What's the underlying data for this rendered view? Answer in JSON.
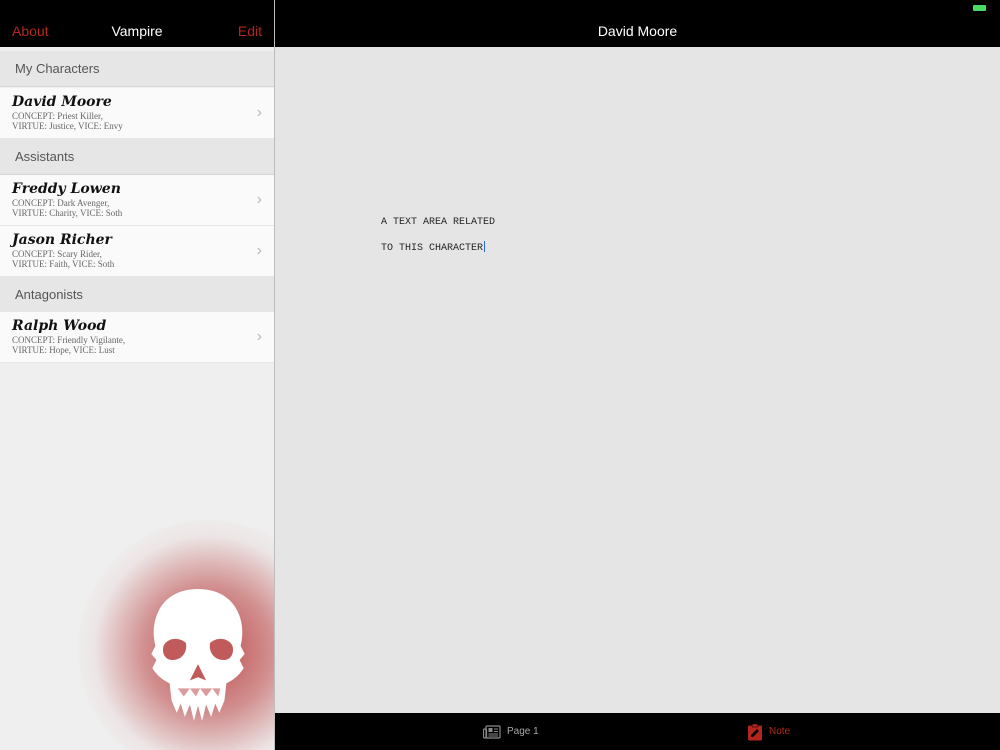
{
  "master": {
    "nav": {
      "left": "About",
      "title": "Vampire",
      "right": "Edit"
    },
    "sections": [
      {
        "title": "My Characters",
        "items": [
          {
            "name": "David Moore",
            "line1": "CONCEPT: Priest Killer,",
            "line2": "VIRTUE: Justice, VICE: Envy"
          }
        ]
      },
      {
        "title": "Assistants",
        "items": [
          {
            "name": "Freddy Lowen",
            "line1": "CONCEPT: Dark Avenger,",
            "line2": "VIRTUE: Charity, VICE: Soth"
          },
          {
            "name": "Jason Richer",
            "line1": "CONCEPT: Scary Rider,",
            "line2": "VIRTUE: Faith, VICE: Soth"
          }
        ]
      },
      {
        "title": "Antagonists",
        "items": [
          {
            "name": "Ralph Wood",
            "line1": "CONCEPT: Friendly Vigilante,",
            "line2": "VIRTUE: Hope, VICE: Lust"
          }
        ]
      }
    ]
  },
  "detail": {
    "title": "David Moore",
    "text_lines": [
      "A TEXT AREA RELATED",
      "TO THIS CHARACTER"
    ]
  },
  "tabbar": {
    "page_label": "Page 1",
    "note_label": "Note"
  },
  "colors": {
    "accent": "#b3261e",
    "nav_bg": "#000000",
    "battery": "#4cd964"
  },
  "icons": {
    "logo": "skull-icon",
    "page_tab": "newspaper-icon",
    "note_tab": "clipboard-icon",
    "chevron": "chevron-right-icon"
  }
}
